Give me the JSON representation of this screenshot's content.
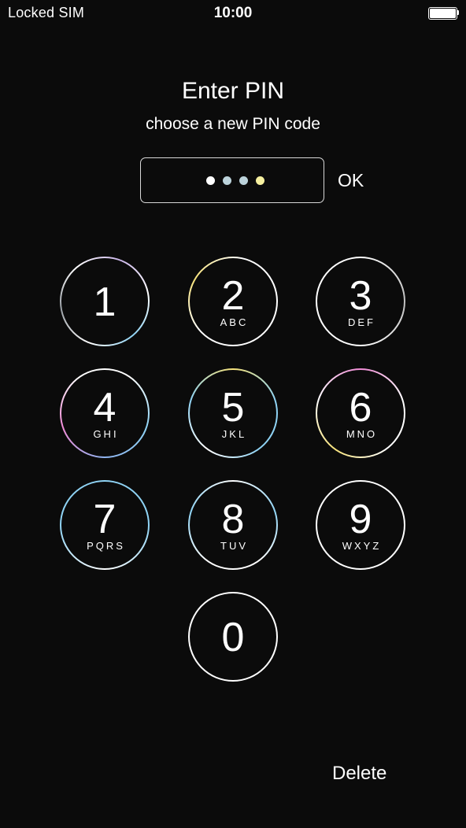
{
  "status_bar": {
    "carrier": "Locked SIM",
    "time": "10:00",
    "battery_icon": "battery-full-icon"
  },
  "title": "Enter PIN",
  "subtitle": "choose a new PIN code",
  "pin_field": {
    "entered_count": 4,
    "dot_colors": [
      "#ffffff",
      "#bcd3db",
      "#bcd3db",
      "#f6f0a0"
    ]
  },
  "ok_label": "OK",
  "keys": [
    {
      "digit": "1",
      "letters": ""
    },
    {
      "digit": "2",
      "letters": "ABC"
    },
    {
      "digit": "3",
      "letters": "DEF"
    },
    {
      "digit": "4",
      "letters": "GHI"
    },
    {
      "digit": "5",
      "letters": "JKL"
    },
    {
      "digit": "6",
      "letters": "MNO"
    },
    {
      "digit": "7",
      "letters": "PQRS"
    },
    {
      "digit": "8",
      "letters": "TUV"
    },
    {
      "digit": "9",
      "letters": "WXYZ"
    },
    {
      "digit": "0",
      "letters": ""
    }
  ],
  "delete_label": "Delete",
  "colors": {
    "background": "#0b0b0b",
    "foreground": "#ffffff",
    "ring_accent_blue": "#8fd3f4",
    "ring_accent_yellow": "#f6e27a",
    "ring_accent_pink": "#f08bd6"
  }
}
